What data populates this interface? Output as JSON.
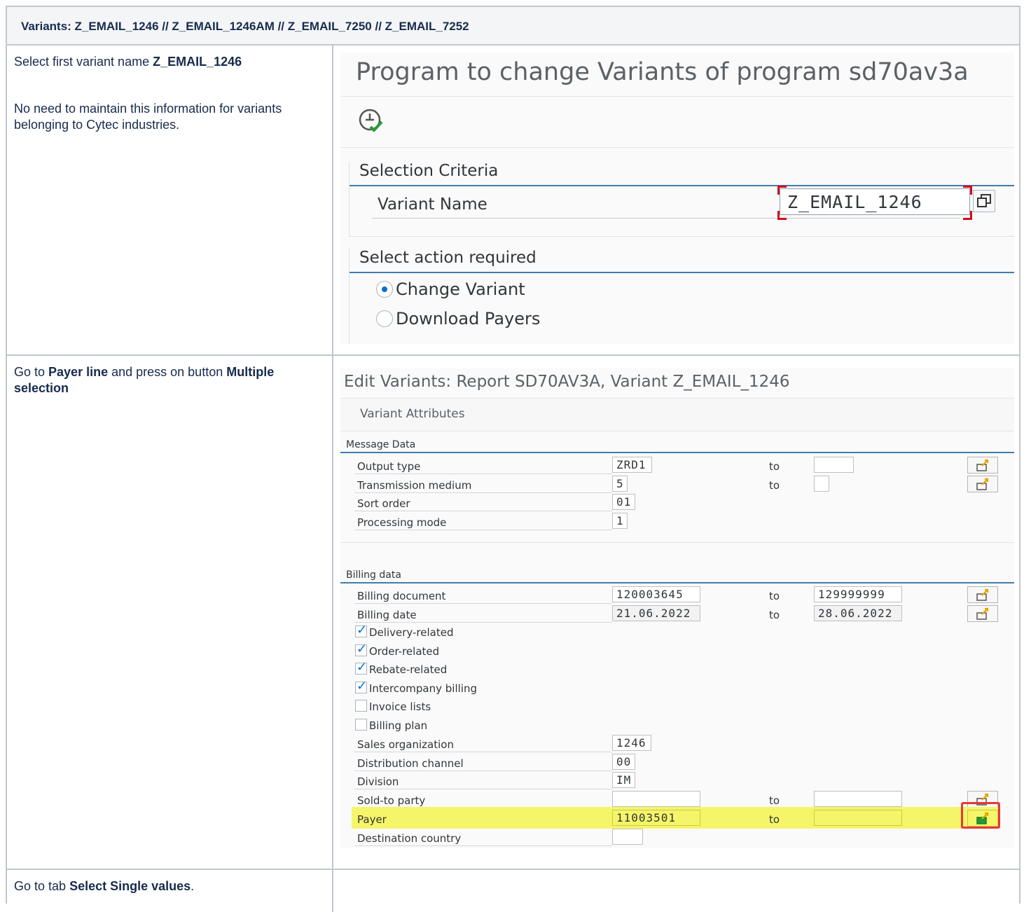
{
  "header": {
    "text": "Variants: Z_EMAIL_1246 // Z_EMAIL_1246AM // Z_EMAIL_7250 //  Z_EMAIL_7252"
  },
  "step1": {
    "line1_prefix": "Select first variant name ",
    "line1_bold": "Z_EMAIL_1246",
    "line2": "No need to maintain this information for variants belonging to Cytec industries.",
    "screen": {
      "title": "Program to change Variants of program sd70av3a",
      "exec_icon": "execute-icon",
      "group1_title": "Selection Criteria",
      "variant_label": "Variant Name",
      "variant_value": "Z_EMAIL_1246",
      "group2_title": "Select action required",
      "radio1": "Change Variant",
      "radio2": "Download Payers",
      "radio_selected": "Change Variant"
    }
  },
  "step2": {
    "t1": "Go to ",
    "b1": "Payer line",
    "t2": " and press on button ",
    "b2": "Multiple selection",
    "screen": {
      "title": "Edit Variants: Report SD70AV3A, Variant Z_EMAIL_1246",
      "subtitle": "Variant Attributes",
      "section1": "Message Data",
      "output_type": {
        "label": "Output type",
        "value": "ZRD1",
        "to": "to",
        "to_value": ""
      },
      "transmission": {
        "label": "Transmission medium",
        "value": "5",
        "to": "to",
        "to_value": ""
      },
      "sort_order": {
        "label": "Sort order",
        "value": "01"
      },
      "processing": {
        "label": "Processing mode",
        "value": "1"
      },
      "section2": "Billing data",
      "billing_doc": {
        "label": "Billing document",
        "value": "120003645",
        "to": "to",
        "to_value": "129999999"
      },
      "billing_date": {
        "label": "Billing date",
        "value": "21.06.2022",
        "to": "to",
        "to_value": "28.06.2022"
      },
      "checkboxes": [
        {
          "label": "Delivery-related",
          "checked": true
        },
        {
          "label": "Order-related",
          "checked": true
        },
        {
          "label": "Rebate-related",
          "checked": true
        },
        {
          "label": "Intercompany billing",
          "checked": true
        },
        {
          "label": "Invoice lists",
          "checked": false
        },
        {
          "label": "Billing plan",
          "checked": false
        }
      ],
      "sales_org": {
        "label": "Sales organization",
        "value": "1246"
      },
      "dist_channel": {
        "label": "Distribution channel",
        "value": "00"
      },
      "division": {
        "label": "Division",
        "value": "IM"
      },
      "sold_to": {
        "label": "Sold-to party",
        "value": "",
        "to": "to",
        "to_value": ""
      },
      "payer": {
        "label": "Payer",
        "value": "11003501",
        "to": "to",
        "to_value": ""
      },
      "dest_country": {
        "label": "Destination country",
        "value": ""
      },
      "highlight_color": "#f5f569",
      "callout_color": "#e53935"
    }
  },
  "step3": {
    "t1": "Go to tab ",
    "b1": "Select Single values",
    "t2": "."
  }
}
